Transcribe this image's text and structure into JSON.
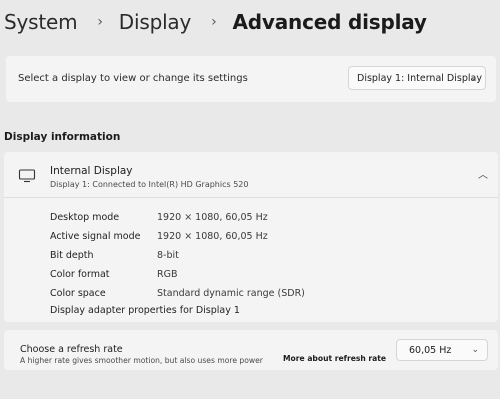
{
  "breadcrumb": {
    "root": "System",
    "middle": "Display",
    "current": "Advanced display",
    "separator": "›"
  },
  "display_select": {
    "label": "Select a display to view or change its settings",
    "selected": "Display 1: Internal Display"
  },
  "section_title": "Display information",
  "display_info": {
    "name": "Internal Display",
    "subtitle": "Display 1: Connected to Intel(R) HD Graphics 520",
    "rows": [
      {
        "key": "Desktop mode",
        "value": "1920 × 1080, 60,05 Hz"
      },
      {
        "key": "Active signal mode",
        "value": "1920 × 1080, 60,05 Hz"
      },
      {
        "key": "Bit depth",
        "value": "8-bit"
      },
      {
        "key": "Color format",
        "value": "RGB"
      },
      {
        "key": "Color space",
        "value": "Standard dynamic range (SDR)"
      }
    ],
    "adapter_link": "Display adapter properties for Display 1"
  },
  "refresh_rate": {
    "title": "Choose a refresh rate",
    "subtitle": "A higher rate gives smoother motion, but also uses more power",
    "link": "More about refresh rate",
    "selected": "60,05 Hz"
  },
  "icons": {
    "monitor": "monitor-icon",
    "chevron_down": "chevron-down-icon",
    "chevron_up": "chevron-up-icon",
    "chevron_right": "chevron-right-icon"
  }
}
